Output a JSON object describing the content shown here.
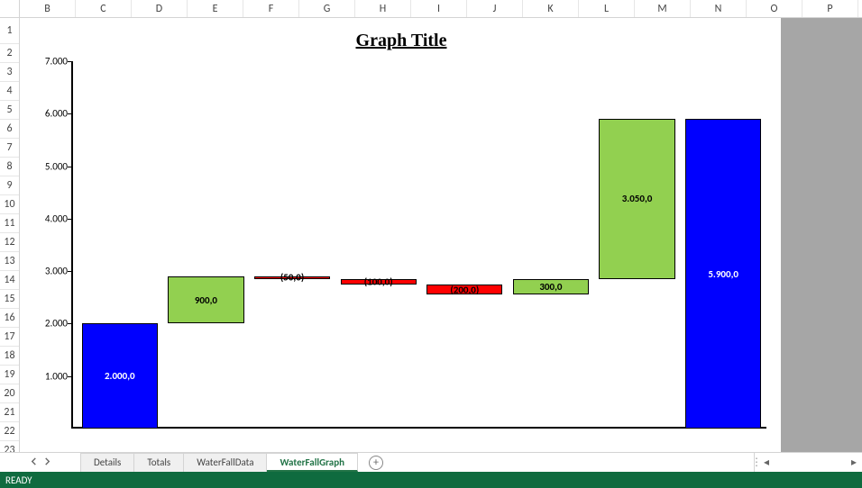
{
  "columns": [
    "B",
    "C",
    "D",
    "E",
    "F",
    "G",
    "H",
    "I",
    "J",
    "K",
    "L",
    "M",
    "N",
    "O",
    "P"
  ],
  "rows": [
    "1",
    "2",
    "3",
    "4",
    "5",
    "6",
    "7",
    "8",
    "9",
    "10",
    "11",
    "12",
    "13",
    "14",
    "15",
    "16",
    "17",
    "18",
    "19",
    "20",
    "21",
    "22",
    "23"
  ],
  "chart": {
    "title": "Graph Title",
    "y_ticks": [
      "1.000",
      "2.000",
      "3.000",
      "4.000",
      "5.000",
      "6.000",
      "7.000"
    ]
  },
  "chart_data": {
    "type": "waterfall",
    "title": "Graph Title",
    "ylabel": "",
    "ylim": [
      0,
      7000
    ],
    "y_tick_interval": 1000,
    "bars": [
      {
        "kind": "total",
        "label": "2.000,0",
        "base": 0,
        "value": 2000,
        "color": "blue"
      },
      {
        "kind": "increase",
        "label": "900,0",
        "base": 2000,
        "value": 900,
        "color": "green"
      },
      {
        "kind": "decrease",
        "label": "(50,0)",
        "base": 2900,
        "value": -50,
        "color": "red"
      },
      {
        "kind": "decrease",
        "label": "(100,0)",
        "base": 2850,
        "value": -100,
        "color": "red"
      },
      {
        "kind": "decrease",
        "label": "(200,0)",
        "base": 2750,
        "value": -200,
        "color": "red"
      },
      {
        "kind": "increase",
        "label": "300,0",
        "base": 2550,
        "value": 300,
        "color": "green"
      },
      {
        "kind": "increase",
        "label": "3.050,0",
        "base": 2850,
        "value": 3050,
        "color": "green"
      },
      {
        "kind": "total",
        "label": "5.900,0",
        "base": 0,
        "value": 5900,
        "color": "blue"
      }
    ]
  },
  "tabs": {
    "items": [
      {
        "label": "Details",
        "active": false
      },
      {
        "label": "Totals",
        "active": false
      },
      {
        "label": "WaterFallData",
        "active": false
      },
      {
        "label": "WaterFallGraph",
        "active": true
      }
    ],
    "add_tooltip": "New sheet"
  },
  "status": {
    "text": "READY"
  }
}
